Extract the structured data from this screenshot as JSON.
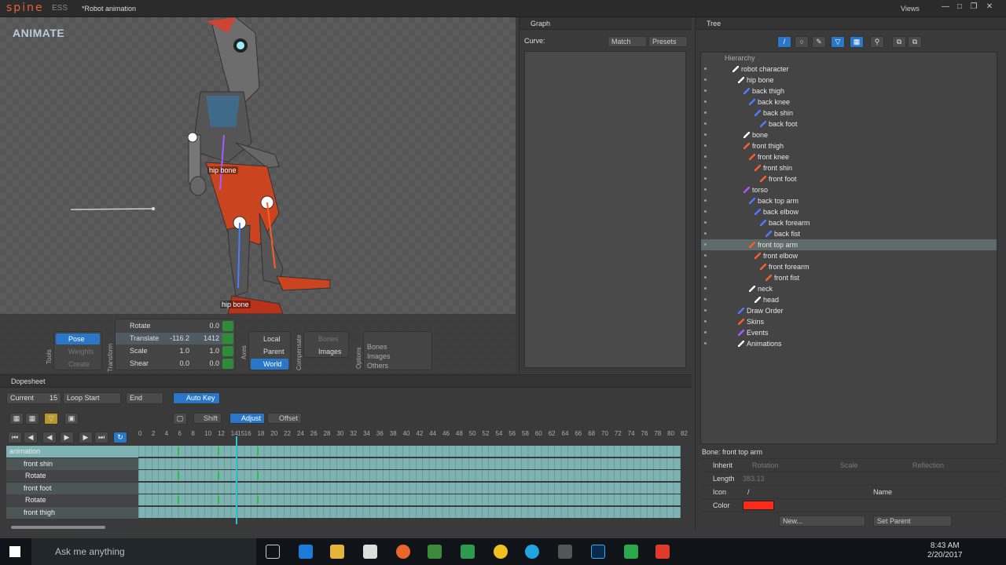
{
  "titlebar": {
    "app": "sp",
    "app2": "ne",
    "edition": "ESS",
    "project": "*Robot animation",
    "views": "Views"
  },
  "viewport": {
    "mode": "ANIMATE",
    "labels": [
      "hip bone",
      "hip bone"
    ]
  },
  "tools": {
    "group_label": "Tools",
    "pose": "Pose",
    "weights": "Weights",
    "create": "Create"
  },
  "transform": {
    "group_label": "Transform",
    "rows": [
      {
        "label": "Rotate",
        "v1": "",
        "v2": "0.0"
      },
      {
        "label": "Translate",
        "v1": "-116.2",
        "v2": "1412"
      },
      {
        "label": "Scale",
        "v1": "1.0",
        "v2": "1.0"
      },
      {
        "label": "Shear",
        "v1": "0.0",
        "v2": "0.0"
      }
    ]
  },
  "axes": {
    "group_label": "Axes",
    "local": "Local",
    "parent": "Parent",
    "world": "World"
  },
  "compensate": {
    "group_label": "Compensate",
    "bones": "Bones",
    "images": "Images"
  },
  "options": {
    "group_label": "Options",
    "rows": [
      "Bones",
      "Images",
      "Others"
    ]
  },
  "graph": {
    "title": "Graph",
    "curve": "Curve:",
    "match": "Match",
    "presets": "Presets"
  },
  "tree": {
    "title": "Tree",
    "hierarchy": "Hierarchy",
    "nodes": [
      {
        "label": "robot character",
        "depth": 0,
        "icon": "iw"
      },
      {
        "label": "hip bone",
        "depth": 1,
        "icon": "iw"
      },
      {
        "label": "back thigh",
        "depth": 2,
        "icon": "ib"
      },
      {
        "label": "back knee",
        "depth": 3,
        "icon": "ib"
      },
      {
        "label": "back shin",
        "depth": 4,
        "icon": "ib"
      },
      {
        "label": "back foot",
        "depth": 5,
        "icon": "ib"
      },
      {
        "label": "bone",
        "depth": 2,
        "icon": "iw"
      },
      {
        "label": "front thigh",
        "depth": 2,
        "icon": "ir"
      },
      {
        "label": "front knee",
        "depth": 3,
        "icon": "ir"
      },
      {
        "label": "front shin",
        "depth": 4,
        "icon": "ir"
      },
      {
        "label": "front foot",
        "depth": 5,
        "icon": "ir"
      },
      {
        "label": "torso",
        "depth": 2,
        "icon": "ip"
      },
      {
        "label": "back top arm",
        "depth": 3,
        "icon": "ib"
      },
      {
        "label": "back elbow",
        "depth": 4,
        "icon": "ib"
      },
      {
        "label": "back forearm",
        "depth": 5,
        "icon": "ib"
      },
      {
        "label": "back fist",
        "depth": 6,
        "icon": "ib"
      },
      {
        "label": "front top arm",
        "depth": 3,
        "icon": "ir",
        "selected": true
      },
      {
        "label": "front elbow",
        "depth": 4,
        "icon": "ir"
      },
      {
        "label": "front forearm",
        "depth": 5,
        "icon": "ir"
      },
      {
        "label": "front fist",
        "depth": 6,
        "icon": "ir"
      },
      {
        "label": "neck",
        "depth": 3,
        "icon": "iw"
      },
      {
        "label": "head",
        "depth": 4,
        "icon": "iw"
      },
      {
        "label": "Draw Order",
        "depth": 1,
        "icon": "ib"
      },
      {
        "label": "Skins",
        "depth": 1,
        "icon": "ir"
      },
      {
        "label": "Events",
        "depth": 1,
        "icon": "ip"
      },
      {
        "label": "Animations",
        "depth": 1,
        "icon": "iw"
      }
    ]
  },
  "props": {
    "title": "Bone: front top arm",
    "inherit": "Inherit",
    "rotation": "Rotation",
    "scale": "Scale",
    "reflection": "Reflection",
    "length": "Length",
    "length_value": "383.13",
    "icon": "Icon",
    "name": "Name",
    "color": "Color",
    "color_value": "#ff2a1a",
    "new": "New...",
    "set_parent": "Set Parent"
  },
  "dopesheet": {
    "title": "Dopesheet",
    "current": "Current",
    "current_value": "15",
    "loop_start": "Loop Start",
    "end": "End",
    "auto_key": "Auto Key",
    "shift": "Shift",
    "adjust": "Adjust",
    "offset": "Offset",
    "ticks": [
      "0",
      "2",
      "4",
      "6",
      "8",
      "10",
      "12",
      "14",
      "15",
      "16",
      "18",
      "20",
      "22",
      "24",
      "26",
      "28",
      "30",
      "32",
      "34",
      "36",
      "38",
      "40",
      "42",
      "44",
      "46",
      "48",
      "50",
      "52",
      "54",
      "56",
      "58",
      "60",
      "62",
      "64",
      "66",
      "68",
      "70",
      "72",
      "74",
      "76",
      "78",
      "80",
      "82"
    ],
    "tracks": [
      {
        "name": "animation",
        "type": "anim"
      },
      {
        "name": "front shin",
        "type": "bone"
      },
      {
        "name": "Rotate",
        "type": "prop"
      },
      {
        "name": "front foot",
        "type": "bone"
      },
      {
        "name": "Rotate",
        "type": "prop"
      },
      {
        "name": "front thigh",
        "type": "bone"
      }
    ],
    "keys": [
      6,
      12,
      18
    ]
  },
  "taskbar": {
    "search": "Ask me anything",
    "time": "8:43 AM",
    "date": "2/20/2017"
  }
}
